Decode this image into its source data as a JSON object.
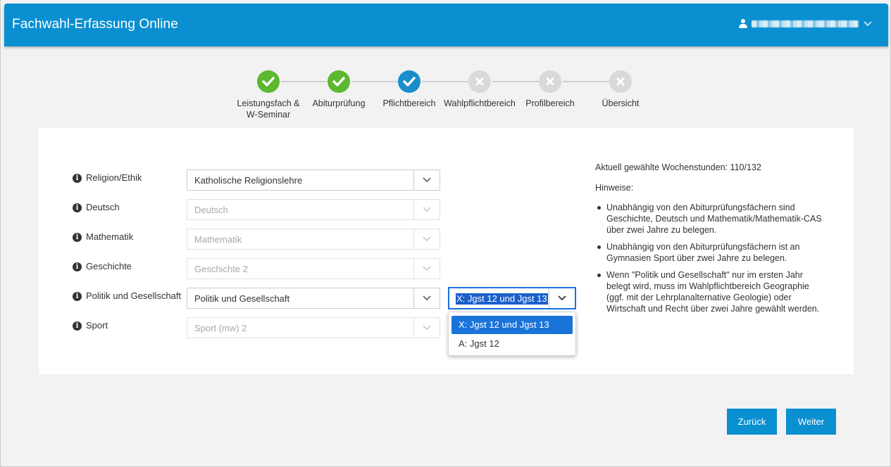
{
  "app": {
    "title": "Fachwahl-Erfassung Online",
    "user_name": ""
  },
  "colors": {
    "brand": "#0a8fd1",
    "done": "#5cb82f",
    "current": "#1a8dcc",
    "pending": "#d9d9d9"
  },
  "steps": [
    {
      "label": "Leistungsfach &\nW-Seminar",
      "state": "done",
      "icon": "check-icon"
    },
    {
      "label": "Abiturprüfung",
      "state": "done",
      "icon": "check-icon"
    },
    {
      "label": "Pflichtbereich",
      "state": "current",
      "icon": "check-icon"
    },
    {
      "label": "Wahlpflichtbereich",
      "state": "pending",
      "icon": "x-icon"
    },
    {
      "label": "Profilbereich",
      "state": "pending",
      "icon": "x-icon"
    },
    {
      "label": "Übersicht",
      "state": "pending",
      "icon": "x-icon"
    }
  ],
  "subjects": [
    {
      "label": "Religion/Ethik",
      "value": "Katholische Religionslehre",
      "enabled": true
    },
    {
      "label": "Deutsch",
      "value": "Deutsch",
      "enabled": false
    },
    {
      "label": "Mathematik",
      "value": "Mathematik",
      "enabled": false
    },
    {
      "label": "Geschichte",
      "value": "Geschichte 2",
      "enabled": false
    },
    {
      "label": "Politik und Gesellschaft",
      "value": "Politik und Gesellschaft",
      "enabled": true
    },
    {
      "label": "Sport",
      "value": "Sport (mw) 2",
      "enabled": false
    }
  ],
  "duration_select": {
    "value": "X: Jgst 12 und Jgst 13",
    "options": [
      "X: Jgst 12 und Jgst 13",
      "A: Jgst 12"
    ]
  },
  "sidebar": {
    "hours": "Aktuell gewählte Wochenstunden: 110/132",
    "hints_title": "Hinweise:",
    "hints": [
      "Unabhängig von den Abiturprüfungsfächern sind Geschichte, Deutsch und Mathematik/Mathematik-CAS über zwei Jahre zu belegen.",
      "Unabhängig von den Abiturprüfungsfächern ist an Gymnasien Sport über zwei Jahre zu belegen.",
      "Wenn \"Politik und Gesellschaft\" nur im ersten Jahr belegt wird, muss im Wahlpflichtbereich Geographie (ggf. mit der Lehrplanalternative Geologie) oder Wirtschaft und Recht über zwei Jahre gewählt werden."
    ]
  },
  "buttons": {
    "back": "Zurück",
    "next": "Weiter"
  }
}
